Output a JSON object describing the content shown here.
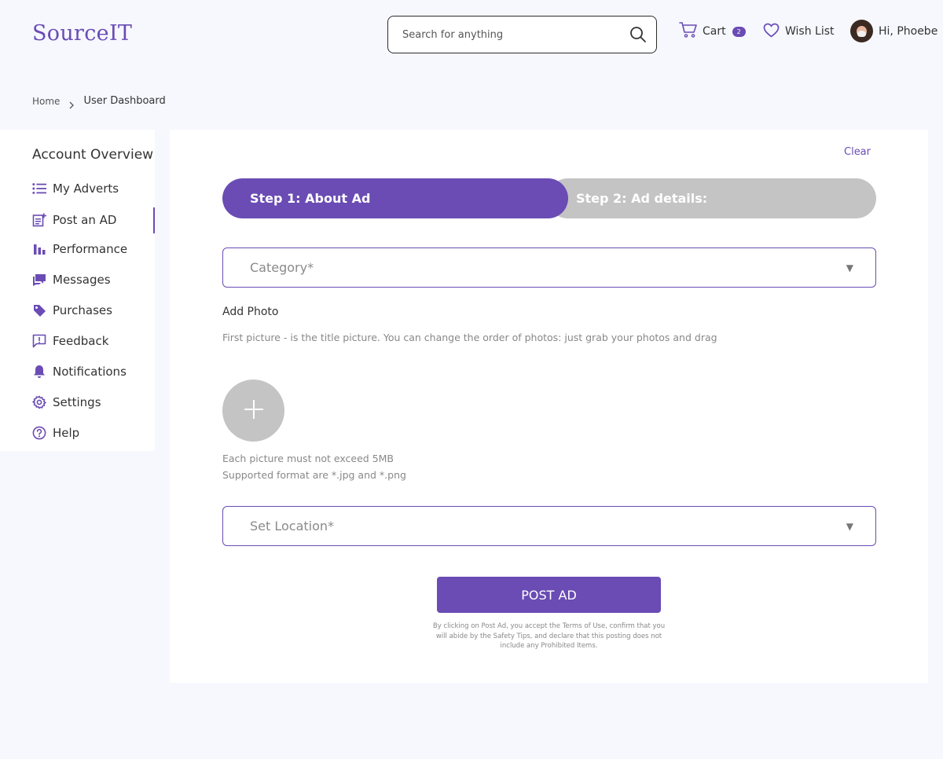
{
  "header": {
    "logo": "SourceIT",
    "search_placeholder": "Search for anything",
    "cart_label": "Cart",
    "cart_count": "2",
    "wishlist_label": "Wish List",
    "greeting": "Hi, Phoebe"
  },
  "breadcrumb": {
    "home": "Home",
    "current": "User Dashboard"
  },
  "sidebar": {
    "title": "Account Overview",
    "active_index": 1,
    "items": [
      {
        "label": "My Adverts",
        "icon": "list-icon"
      },
      {
        "label": "Post an AD",
        "icon": "post-ad-icon"
      },
      {
        "label": "Performance",
        "icon": "bar-chart-icon"
      },
      {
        "label": "Messages",
        "icon": "chat-icon"
      },
      {
        "label": "Purchases",
        "icon": "tag-icon"
      },
      {
        "label": "Feedback",
        "icon": "feedback-icon"
      },
      {
        "label": "Notifications",
        "icon": "bell-icon"
      },
      {
        "label": "Settings",
        "icon": "gear-icon"
      },
      {
        "label": "Help",
        "icon": "help-icon"
      }
    ]
  },
  "main": {
    "clear_label": "Clear",
    "step1_label": "Step 1: About Ad",
    "step2_label": "Step 2: Ad details:",
    "category_label": "Category*",
    "add_photo_title": "Add Photo",
    "photo_hint": "First picture - is the title picture. You can change the order of photos: just grab your photos and drag",
    "photo_rule_size": "Each picture must not exceed 5MB",
    "photo_rule_format": "Supported format are *.jpg and *.png",
    "location_label": "Set Location*",
    "post_button": "POST AD",
    "terms": "By clicking on Post Ad, you accept the Terms of Use, confirm that you will abide by the Safety Tips, and declare that this posting does not include any Prohibited Items."
  },
  "colors": {
    "accent": "#6a4cb4",
    "page_bg": "#f6f8fe",
    "inactive_step": "#c4c4c4"
  }
}
